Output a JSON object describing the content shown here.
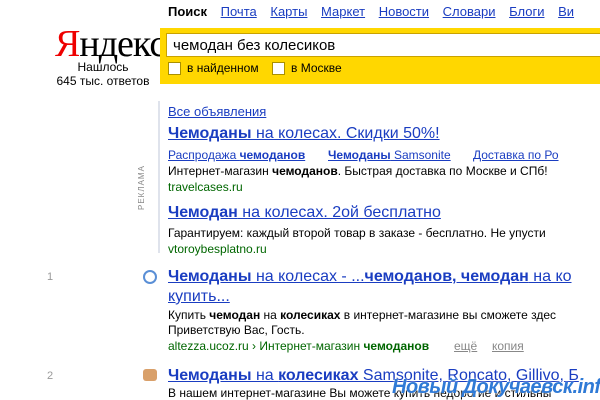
{
  "nav": {
    "items": [
      "Поиск",
      "Почта",
      "Карты",
      "Маркет",
      "Новости",
      "Словари",
      "Блоги",
      "Ви"
    ]
  },
  "logo": {
    "first": "Я",
    "rest": "ндекс"
  },
  "stats": {
    "found_label": "Нашлось",
    "count": "645 тыс. ответов"
  },
  "search": {
    "query": "чемодан без колесиков",
    "filter_found": "в найденном",
    "filter_moscow": "в Москве"
  },
  "ads": {
    "all_ads": "Все объявления",
    "label": "РЕКЛАМА",
    "ad1": {
      "title_bold": "Чемоданы",
      "title_rest": " на колесах. Скидки 50%!",
      "sub1_a": "Распродажа ",
      "sub1_b": "чемоданов",
      "sub2_a": "Чемоданы",
      "sub2_b": " Samsonite",
      "sub3": "Доставка по Ро",
      "snippet_a": "Интернет-магазин ",
      "snippet_b": "чемоданов",
      "snippet_c": ". Быстрая доставка по Москве и СПб!",
      "url": "travelcases.ru"
    },
    "ad2": {
      "title_bold": "Чемодан",
      "title_rest": " на колесах. 2ой бесплатно",
      "snippet": "Гарантируем: каждый второй товар в заказе - бесплатно. Не упусти",
      "url": "vtoroybesplatno.ru"
    }
  },
  "results": [
    {
      "num": "1",
      "favicon": "globe-favicon",
      "title_1": "Чемоданы",
      "title_2": " на колесах - ...",
      "title_3": "чемоданов, чемодан",
      "title_4": " на ко",
      "title_line2": "купить...",
      "snippet_a": "Купить ",
      "snippet_b": "чемодан",
      "snippet_c": " на ",
      "snippet_d": "колесиках",
      "snippet_e": " в интернет-магазине вы сможете здес",
      "snippet_line2": "Приветствую Вас, Гость.",
      "url_a": "altezza.ucoz.ru › Интернет-магазин ",
      "url_b": "чемоданов",
      "more": "ещё",
      "cache": "копия"
    },
    {
      "num": "2",
      "favicon": "shop-favicon",
      "title_1": "Чемоданы",
      "title_2": " на ",
      "title_3": "колесиках",
      "title_4": " Samsonite, Roncato, Gillivo, Б",
      "snippet": "В нашем интернет-магазине Вы можете купить недорогие и стильны"
    }
  ],
  "watermark": "Новый Докучаевск.info",
  "colors": {
    "accent": "#ffd700",
    "link": "#1a3dc1",
    "url": "#006600",
    "brand_red": "#ee0000"
  }
}
